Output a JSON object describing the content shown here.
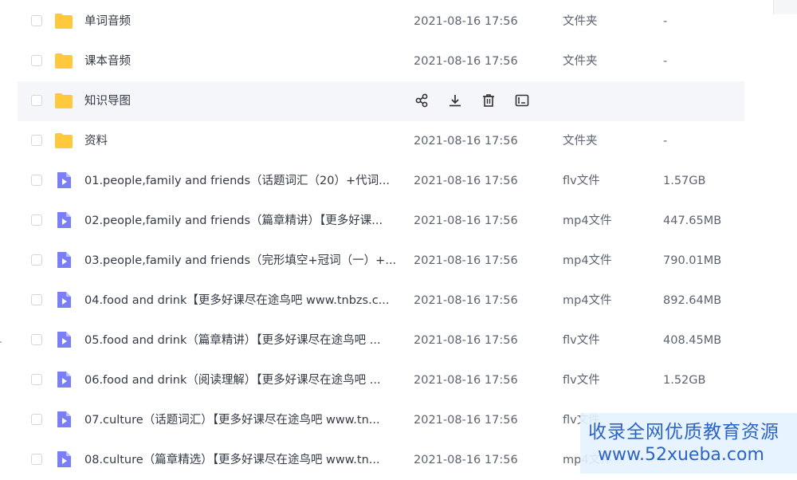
{
  "files": [
    {
      "name": "单词音频",
      "kind": "folder",
      "date": "2021-08-16 17:56",
      "type": "文件夹",
      "size": "-"
    },
    {
      "name": "课本音频",
      "kind": "folder",
      "date": "2021-08-16 17:56",
      "type": "文件夹",
      "size": "-"
    },
    {
      "name": "知识导图",
      "kind": "folder",
      "date": "",
      "type": "",
      "size": "",
      "hovered": true
    },
    {
      "name": "资料",
      "kind": "folder",
      "date": "2021-08-16 17:56",
      "type": "文件夹",
      "size": "-"
    },
    {
      "name": "01.people,family and friends（话题词汇（20）+代词...",
      "kind": "video",
      "date": "2021-08-16 17:56",
      "type": "flv文件",
      "size": "1.57GB"
    },
    {
      "name": "02.people,family and friends（篇章精讲）【更多好课...",
      "kind": "video",
      "date": "2021-08-16 17:56",
      "type": "mp4文件",
      "size": "447.65MB"
    },
    {
      "name": "03.people,family and friends（完形填空+冠词（一）+...",
      "kind": "video",
      "date": "2021-08-16 17:56",
      "type": "mp4文件",
      "size": "790.01MB"
    },
    {
      "name": "04.food and drink【更多好课尽在途鸟吧 www.tnbzs.c...",
      "kind": "video",
      "date": "2021-08-16 17:56",
      "type": "mp4文件",
      "size": "892.64MB"
    },
    {
      "name": "05.food and drink（篇章精讲）【更多好课尽在途鸟吧 ...",
      "kind": "video",
      "date": "2021-08-16 17:56",
      "type": "flv文件",
      "size": "408.45MB"
    },
    {
      "name": "06.food and drink（阅读理解）【更多好课尽在途鸟吧 ...",
      "kind": "video",
      "date": "2021-08-16 17:56",
      "type": "flv文件",
      "size": "1.52GB"
    },
    {
      "name": "07.culture（话题词汇）【更多好课尽在途鸟吧 www.tn...",
      "kind": "video",
      "date": "2021-08-16 17:56",
      "type": "flv文件",
      "size": ""
    },
    {
      "name": "08.culture（篇章精选）【更多好课尽在途鸟吧 www.tn...",
      "kind": "video",
      "date": "2021-08-16 17:56",
      "type": "mp4文件",
      "size": ""
    }
  ],
  "hover_actions": [
    "share-icon",
    "download-icon",
    "delete-icon",
    "rename-icon"
  ],
  "watermark": {
    "line1": "收录全网优质教育资源",
    "line2": "www.52xueba.com"
  },
  "colors": {
    "folder": "#ffc83d",
    "video": "#7b7ff5",
    "hover_row": "#f5f6f9",
    "watermark_text": "#2b63c7"
  }
}
